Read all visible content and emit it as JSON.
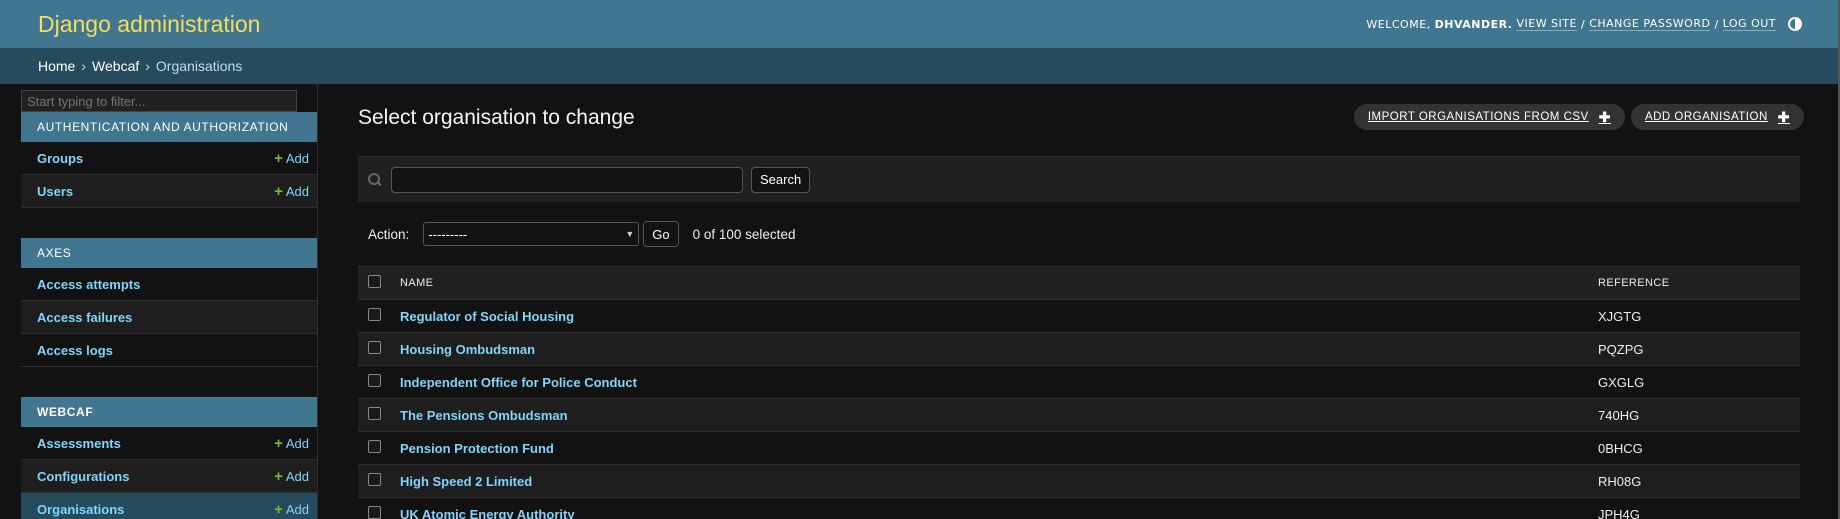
{
  "header": {
    "branding": "Django administration",
    "welcome": "WELCOME,",
    "username": "DHVANDER.",
    "view_site": "VIEW SITE",
    "change_password": "CHANGE PASSWORD",
    "log_out": "LOG OUT",
    "separator": "/",
    "theme_icon": "contrast-icon"
  },
  "breadcrumbs": {
    "home": "Home",
    "app": "Webcaf",
    "current": "Organisations",
    "arrow": "›"
  },
  "sidebar": {
    "filter_placeholder": "Start typing to filter...",
    "add_label": "Add",
    "modules": [
      {
        "caption": "Authentication and Authorization",
        "models": [
          {
            "name": "Groups",
            "has_add": true
          },
          {
            "name": "Users",
            "has_add": true
          }
        ]
      },
      {
        "caption": "Axes",
        "models": [
          {
            "name": "Access attempts",
            "has_add": false
          },
          {
            "name": "Access failures",
            "has_add": false
          },
          {
            "name": "Access logs",
            "has_add": false
          }
        ]
      },
      {
        "caption": "Webcaf",
        "models": [
          {
            "name": "Assessments",
            "has_add": true
          },
          {
            "name": "Configurations",
            "has_add": true
          },
          {
            "name": "Organisations",
            "has_add": true
          }
        ]
      }
    ]
  },
  "content": {
    "title": "Select organisation to change",
    "import_button": "IMPORT ORGANISATIONS FROM CSV",
    "add_button": "ADD ORGANISATION",
    "search_button": "Search",
    "action_label": "Action:",
    "action_selected": "---------",
    "go_button": "Go",
    "selection_counter": "0 of 100 selected",
    "columns": {
      "name": "NAME",
      "reference": "REFERENCE"
    },
    "rows": [
      {
        "name": "Regulator of Social Housing",
        "reference": "XJGTG"
      },
      {
        "name": "Housing Ombudsman",
        "reference": "PQZPG"
      },
      {
        "name": "Independent Office for Police Conduct",
        "reference": "GXGLG"
      },
      {
        "name": "The Pensions Ombudsman",
        "reference": "740HG"
      },
      {
        "name": "Pension Protection Fund",
        "reference": "0BHCG"
      },
      {
        "name": "High Speed 2 Limited",
        "reference": "RH08G"
      },
      {
        "name": "UK Atomic Energy Authority",
        "reference": "JPH4G"
      }
    ]
  },
  "colors": {
    "header_bg": "#417690",
    "branding": "#f5dd5d",
    "breadcrumbs_bg": "#264b5d",
    "link": "#81d4fa",
    "add_plus": "#70bf2b"
  }
}
